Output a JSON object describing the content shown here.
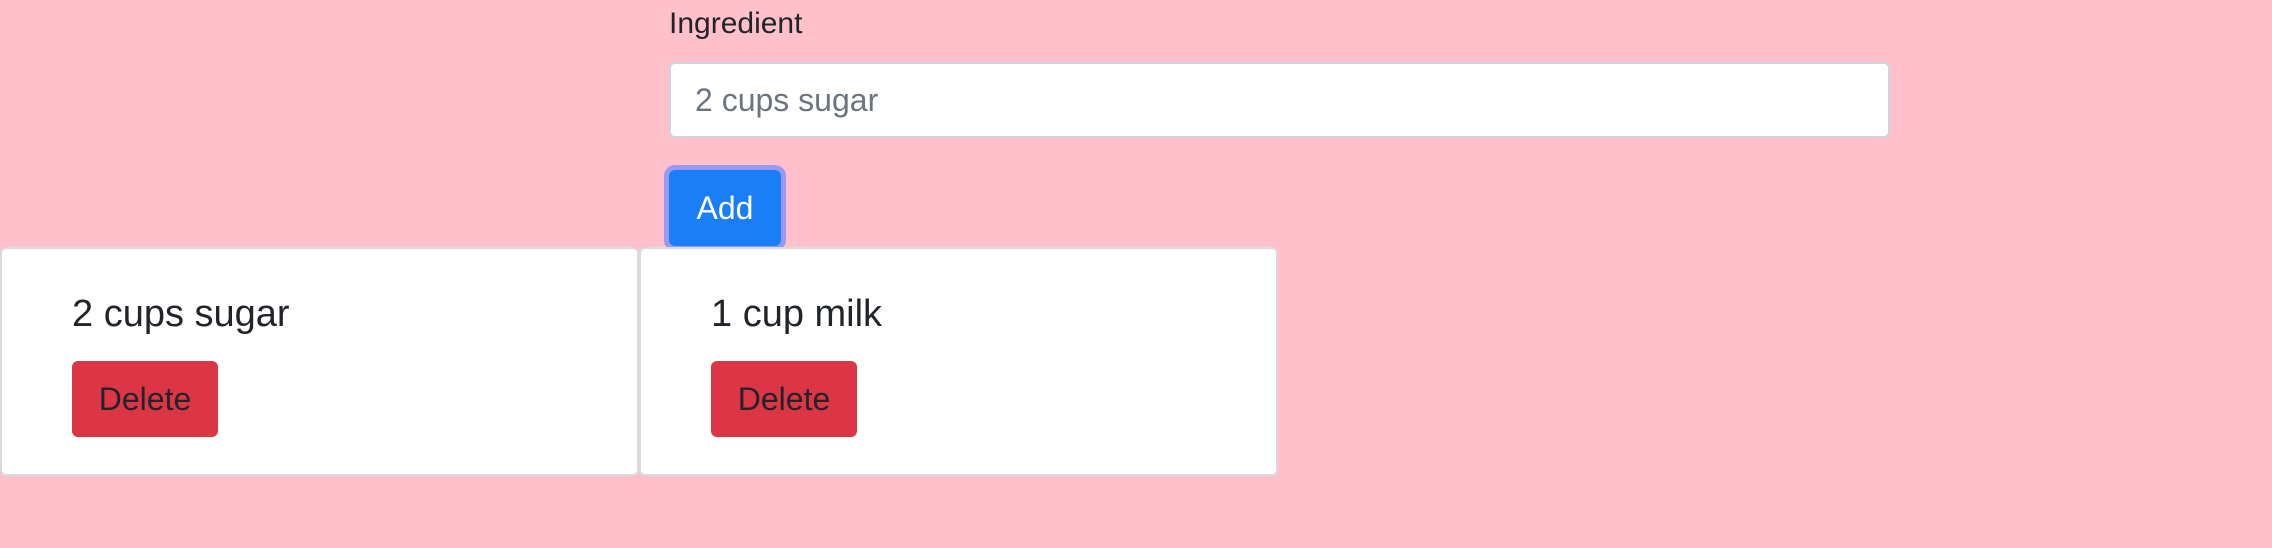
{
  "form": {
    "label": "Ingredient",
    "input_placeholder": "2 cups sugar",
    "input_value": "",
    "add_label": "Add"
  },
  "ingredients": [
    {
      "name": "2 cups sugar",
      "delete_label": "Delete"
    },
    {
      "name": "1 cup milk",
      "delete_label": "Delete"
    }
  ],
  "colors": {
    "background": "#ffc0cb",
    "add_button": "#1a7ef6",
    "delete_button": "#dc3545",
    "card": "#ffffff"
  }
}
